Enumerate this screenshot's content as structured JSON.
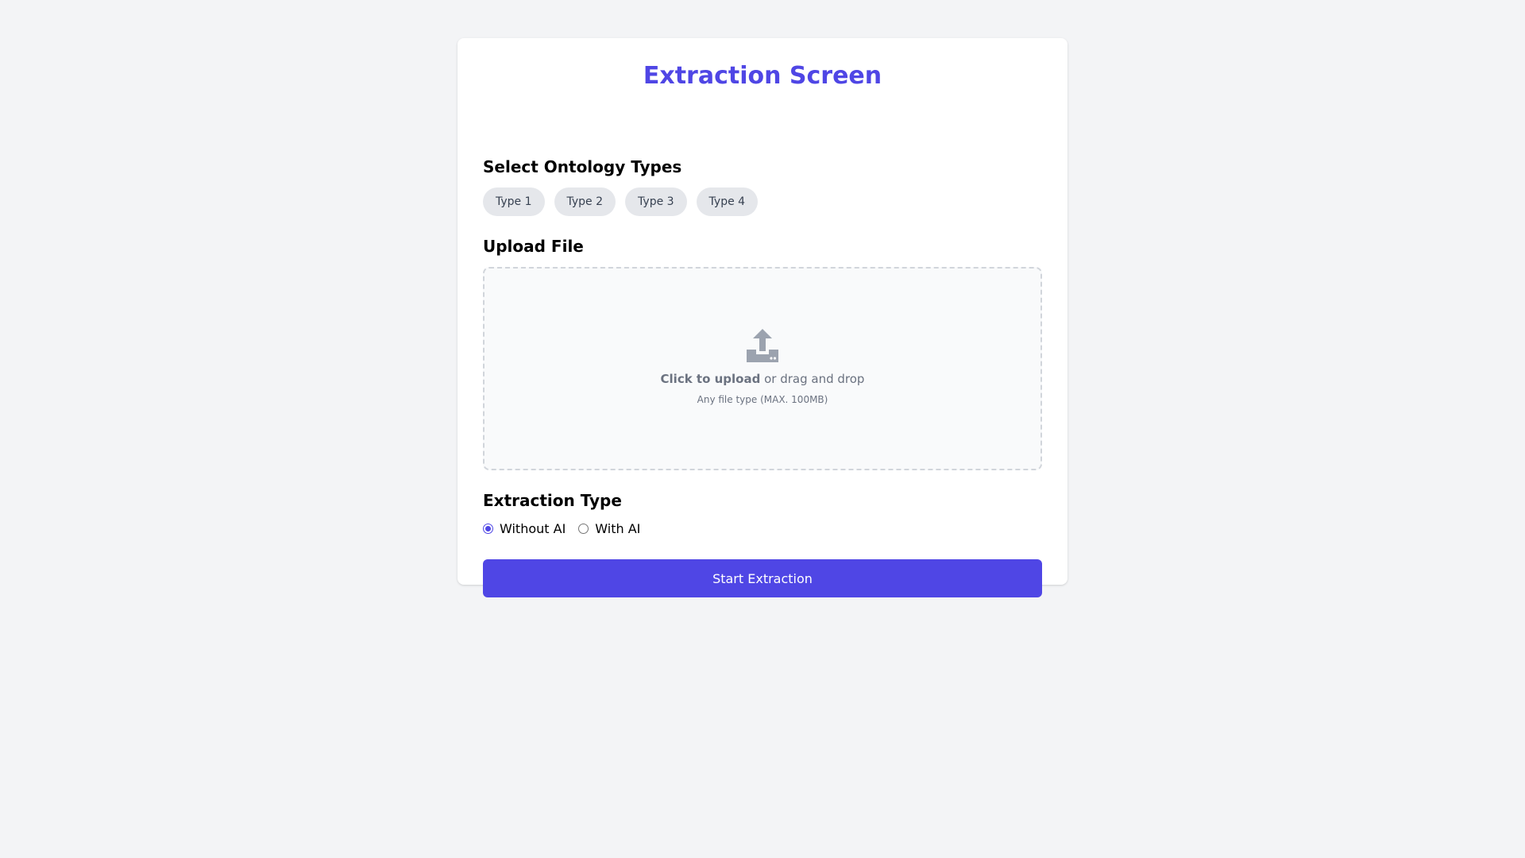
{
  "title": "Extraction Screen",
  "ontology": {
    "heading": "Select Ontology Types",
    "types": [
      "Type 1",
      "Type 2",
      "Type 3",
      "Type 4"
    ]
  },
  "upload": {
    "heading": "Upload File",
    "click_label": "Click to upload",
    "drag_label": " or drag and drop",
    "hint": "Any file type (MAX. 100MB)",
    "icon": "upload-icon"
  },
  "extraction": {
    "heading": "Extraction Type",
    "options": [
      {
        "label": "Without AI",
        "selected": true
      },
      {
        "label": "With AI",
        "selected": false
      }
    ]
  },
  "start_button_label": "Start Extraction",
  "colors": {
    "accent": "#4f46e5",
    "background": "#f3f4f6",
    "chip": "#e5e7eb"
  }
}
